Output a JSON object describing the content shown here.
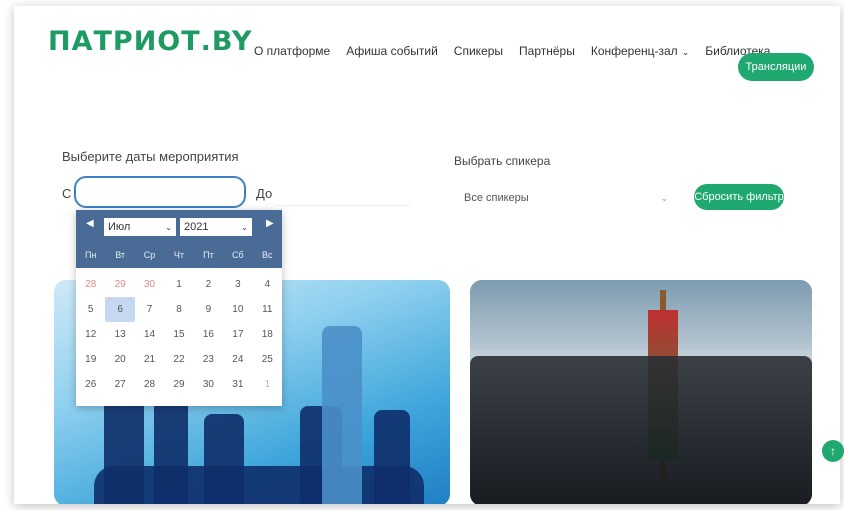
{
  "logo": "ПАТРИОТ.BY",
  "nav": [
    {
      "label": "О платформе",
      "chev": ""
    },
    {
      "label": "Афиша событий",
      "chev": ""
    },
    {
      "label": "Спикеры",
      "chev": ""
    },
    {
      "label": "Партнёры",
      "chev": ""
    },
    {
      "label": "Конференц-зал",
      "chev": "⌄"
    },
    {
      "label": "Библиотека",
      "chev": "⌄"
    }
  ],
  "live_button": "Трансляции",
  "filters": {
    "dates_title": "Выберите даты мероприятия",
    "from_label": "С",
    "to_label": "До",
    "speaker_title": "Выбрать спикера",
    "speaker_value": "Все спикеры",
    "reset_button": "Сбросить фильтр"
  },
  "datepicker": {
    "month": "Июл",
    "year": "2021",
    "weekdays": [
      "Пн",
      "Вт",
      "Ср",
      "Чт",
      "Пт",
      "Сб",
      "Вс"
    ],
    "days": [
      [
        "28",
        "29",
        "30",
        "1",
        "2",
        "3",
        "4"
      ],
      [
        "5",
        "6",
        "7",
        "8",
        "9",
        "10",
        "11"
      ],
      [
        "12",
        "13",
        "14",
        "15",
        "16",
        "17",
        "18"
      ],
      [
        "19",
        "20",
        "21",
        "22",
        "23",
        "24",
        "25"
      ],
      [
        "26",
        "27",
        "28",
        "29",
        "30",
        "31",
        "1"
      ]
    ],
    "selected": "6"
  },
  "scroll_up": "↑"
}
